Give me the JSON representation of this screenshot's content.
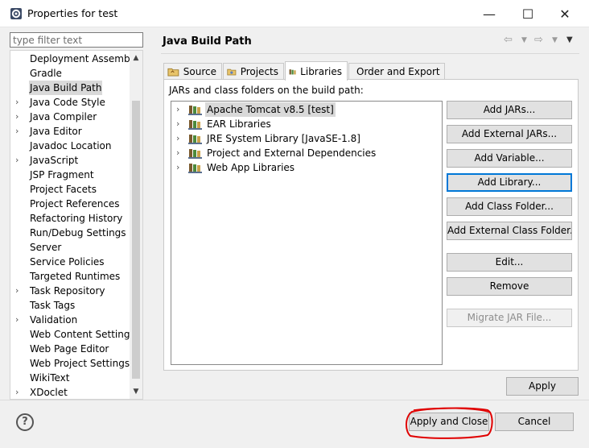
{
  "window": {
    "title": "Properties for test",
    "min_glyph": "—",
    "max_glyph": "☐",
    "close_glyph": "✕"
  },
  "filter": {
    "placeholder": "type filter text",
    "value": ""
  },
  "nav": {
    "items": [
      {
        "label": "Deployment Assembly",
        "expandable": false,
        "selected": false
      },
      {
        "label": "Gradle",
        "expandable": false,
        "selected": false
      },
      {
        "label": "Java Build Path",
        "expandable": false,
        "selected": true
      },
      {
        "label": "Java Code Style",
        "expandable": true,
        "selected": false
      },
      {
        "label": "Java Compiler",
        "expandable": true,
        "selected": false
      },
      {
        "label": "Java Editor",
        "expandable": true,
        "selected": false
      },
      {
        "label": "Javadoc Location",
        "expandable": false,
        "selected": false
      },
      {
        "label": "JavaScript",
        "expandable": true,
        "selected": false
      },
      {
        "label": "JSP Fragment",
        "expandable": false,
        "selected": false
      },
      {
        "label": "Project Facets",
        "expandable": false,
        "selected": false
      },
      {
        "label": "Project References",
        "expandable": false,
        "selected": false
      },
      {
        "label": "Refactoring History",
        "expandable": false,
        "selected": false
      },
      {
        "label": "Run/Debug Settings",
        "expandable": false,
        "selected": false
      },
      {
        "label": "Server",
        "expandable": false,
        "selected": false
      },
      {
        "label": "Service Policies",
        "expandable": false,
        "selected": false
      },
      {
        "label": "Targeted Runtimes",
        "expandable": false,
        "selected": false
      },
      {
        "label": "Task Repository",
        "expandable": true,
        "selected": false
      },
      {
        "label": "Task Tags",
        "expandable": false,
        "selected": false
      },
      {
        "label": "Validation",
        "expandable": true,
        "selected": false
      },
      {
        "label": "Web Content Settings",
        "expandable": false,
        "selected": false
      },
      {
        "label": "Web Page Editor",
        "expandable": false,
        "selected": false
      },
      {
        "label": "Web Project Settings",
        "expandable": false,
        "selected": false
      },
      {
        "label": "WikiText",
        "expandable": false,
        "selected": false
      },
      {
        "label": "XDoclet",
        "expandable": true,
        "selected": false
      }
    ]
  },
  "page": {
    "title": "Java Build Path"
  },
  "tabs": [
    {
      "label": "Source",
      "icon": "source-folder-icon",
      "active": false
    },
    {
      "label": "Projects",
      "icon": "projects-icon",
      "active": false
    },
    {
      "label": "Libraries",
      "icon": "libraries-icon",
      "active": true
    },
    {
      "label": "Order and Export",
      "icon": "order-export-icon",
      "active": false
    }
  ],
  "panel": {
    "label": "JARs and class folders on the build path:"
  },
  "libraries": [
    {
      "label": "Apache Tomcat v8.5 [test]",
      "selected": true
    },
    {
      "label": "EAR Libraries",
      "selected": false
    },
    {
      "label": "JRE System Library [JavaSE-1.8]",
      "selected": false
    },
    {
      "label": "Project and External Dependencies",
      "selected": false
    },
    {
      "label": "Web App Libraries",
      "selected": false
    }
  ],
  "buttons": {
    "add_jars": "Add JARs...",
    "add_external_jars": "Add External JARs...",
    "add_variable": "Add Variable...",
    "add_library": "Add Library...",
    "add_class_folder": "Add Class Folder...",
    "add_external_class_folder": "Add External Class Folder...",
    "edit": "Edit...",
    "remove": "Remove",
    "migrate_jar": "Migrate JAR File...",
    "apply": "Apply",
    "apply_and_close": "Apply and Close",
    "cancel": "Cancel"
  },
  "help": {
    "glyph": "?"
  },
  "colors": {
    "focus_blue": "#0078d7",
    "annotation_red": "#e00000",
    "selection_gray": "#d9d9d9"
  }
}
